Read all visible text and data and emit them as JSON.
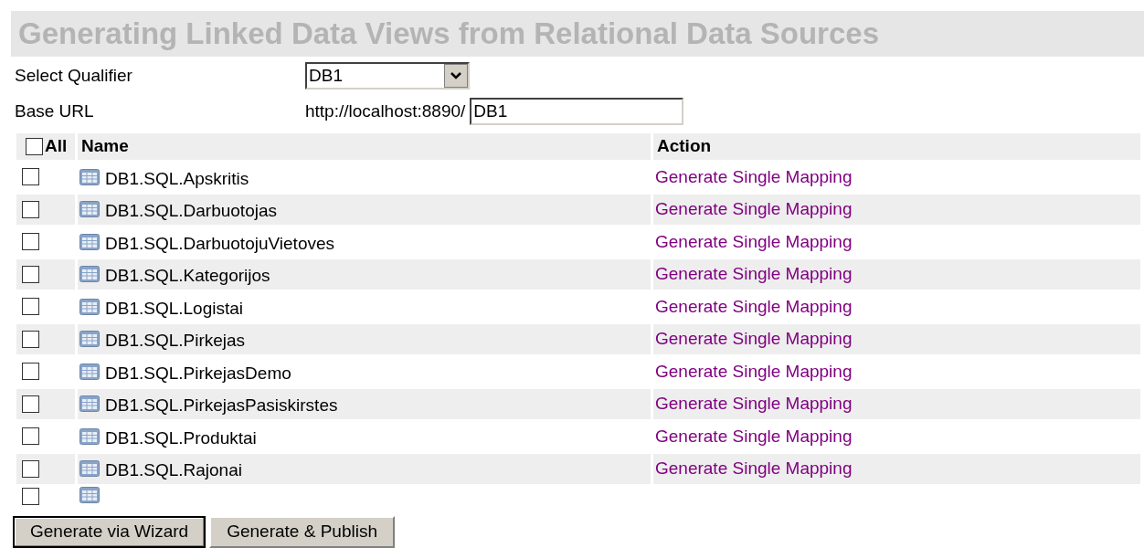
{
  "title": "Generating Linked Data Views from Relational Data Sources",
  "qualifier": {
    "label": "Select Qualifier",
    "value": "DB1"
  },
  "base_url": {
    "label": "Base URL",
    "prefix": "http://localhost:8890/",
    "value": "DB1"
  },
  "table": {
    "columns": [
      {
        "label": "All",
        "checked": false
      },
      {
        "label": "Name"
      },
      {
        "label": "Action"
      }
    ],
    "rows": [
      {
        "checked": false,
        "name": "DB1.SQL.Apskritis",
        "action": "Generate Single Mapping"
      },
      {
        "checked": false,
        "name": "DB1.SQL.Darbuotojas",
        "action": "Generate Single Mapping"
      },
      {
        "checked": false,
        "name": "DB1.SQL.DarbuotojuVietoves",
        "action": "Generate Single Mapping"
      },
      {
        "checked": false,
        "name": "DB1.SQL.Kategorijos",
        "action": "Generate Single Mapping"
      },
      {
        "checked": false,
        "name": "DB1.SQL.Logistai",
        "action": "Generate Single Mapping"
      },
      {
        "checked": false,
        "name": "DB1.SQL.Pirkejas",
        "action": "Generate Single Mapping"
      },
      {
        "checked": false,
        "name": "DB1.SQL.PirkejasDemo",
        "action": "Generate Single Mapping"
      },
      {
        "checked": false,
        "name": "DB1.SQL.PirkejasPasiskirstes",
        "action": "Generate Single Mapping"
      },
      {
        "checked": false,
        "name": "DB1.SQL.Produktai",
        "action": "Generate Single Mapping"
      },
      {
        "checked": false,
        "name": "DB1.SQL.Rajonai",
        "action": "Generate Single Mapping"
      }
    ],
    "cut_row": {
      "checked": false
    }
  },
  "buttons": [
    {
      "label": "Generate via Wizard",
      "focused": true
    },
    {
      "label": "Generate & Publish",
      "focused": false
    }
  ]
}
